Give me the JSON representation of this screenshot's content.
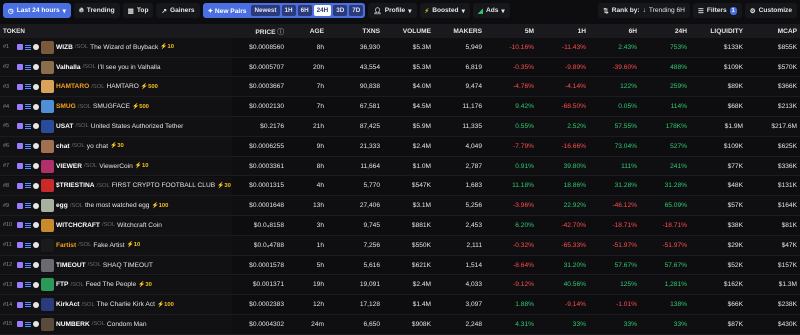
{
  "toolbar": {
    "timeframe": "Last 24 hours",
    "trending": "Trending",
    "top": "Top",
    "gainers": "Gainers",
    "new_pairs": "New Pairs",
    "newest": "Newest",
    "tf_options": [
      "1H",
      "6H",
      "24H",
      "3D",
      "7D"
    ],
    "tf_active": "24H",
    "profile": "Profile",
    "boosted": "Boosted",
    "ads": "Ads",
    "rank_by": "Rank by:",
    "rank_value": "Trending 6H",
    "filters": "Filters",
    "filters_count": "1",
    "customize": "Customize"
  },
  "columns": {
    "token": "TOKEN",
    "price": "PRICE",
    "age": "AGE",
    "txns": "TXNS",
    "volume": "VOLUME",
    "makers": "MAKERS",
    "m5": "5M",
    "h1": "1H",
    "h6": "6H",
    "h24": "24H",
    "liquidity": "LIQUIDITY",
    "mcap": "MCAP"
  },
  "rows": [
    {
      "rank": "#1",
      "symbol": "WIZB",
      "quote": "/SOL",
      "name": "The Wizard of Buyback",
      "boost": "⚡10",
      "sym_orange": false,
      "avatar": "#7a5a3a",
      "price": "$0.0008560",
      "age": "8h",
      "txns": "36,930",
      "volume": "$5.3M",
      "makers": "5,949",
      "m5": "-10.16%",
      "h1": "-11.43%",
      "h6": "2.43%",
      "h24": "753%",
      "liquidity": "$133K",
      "mcap": "$855K"
    },
    {
      "rank": "#2",
      "symbol": "Valhalla",
      "quote": "/SOL",
      "name": "I'll see you in Valhalla",
      "boost": "",
      "sym_orange": false,
      "avatar": "#8a6d4a",
      "price": "$0.0005707",
      "age": "20h",
      "txns": "43,554",
      "volume": "$5.3M",
      "makers": "6,819",
      "m5": "-0.35%",
      "h1": "-9.89%",
      "h6": "-39.60%",
      "h24": "488%",
      "liquidity": "$109K",
      "mcap": "$570K"
    },
    {
      "rank": "#3",
      "symbol": "HAMTARO",
      "quote": "/SOL",
      "name": "HAMTARO",
      "boost": "⚡500",
      "sym_orange": true,
      "avatar": "#d9a45a",
      "price": "$0.0003667",
      "age": "7h",
      "txns": "90,838",
      "volume": "$4.0M",
      "makers": "9,474",
      "m5": "-4.76%",
      "h1": "-4.14%",
      "h6": "122%",
      "h24": "259%",
      "liquidity": "$89K",
      "mcap": "$366K"
    },
    {
      "rank": "#4",
      "symbol": "SMUG",
      "quote": "/SOL",
      "name": "SMUGFACE",
      "boost": "⚡500",
      "sym_orange": true,
      "avatar": "#4f8fd6",
      "price": "$0.0002130",
      "age": "7h",
      "txns": "67,581",
      "volume": "$4.5M",
      "makers": "11,176",
      "m5": "9.42%",
      "h1": "-68.50%",
      "h6": "0.05%",
      "h24": "114%",
      "liquidity": "$68K",
      "mcap": "$213K"
    },
    {
      "rank": "#5",
      "symbol": "USAT",
      "quote": "/SOL",
      "name": "United States Authorized Tether",
      "boost": "",
      "sym_orange": false,
      "avatar": "#2a4a9a",
      "price": "$0.2176",
      "age": "21h",
      "txns": "87,425",
      "volume": "$5.9M",
      "makers": "11,335",
      "m5": "0.55%",
      "h1": "2.52%",
      "h6": "57.55%",
      "h24": "178K%",
      "liquidity": "$1.9M",
      "mcap": "$217.6M"
    },
    {
      "rank": "#6",
      "symbol": "chat",
      "quote": "/SOL",
      "name": "yo chat",
      "boost": "⚡30",
      "sym_orange": false,
      "avatar": "#a07050",
      "price": "$0.0006255",
      "age": "9h",
      "txns": "21,333",
      "volume": "$2.4M",
      "makers": "4,049",
      "m5": "-7.79%",
      "h1": "-16.66%",
      "h6": "73.04%",
      "h24": "527%",
      "liquidity": "$109K",
      "mcap": "$625K"
    },
    {
      "rank": "#7",
      "symbol": "VIEWER",
      "quote": "/SOL",
      "name": "ViewerCoin",
      "boost": "⚡10",
      "sym_orange": false,
      "avatar": "#b0306a",
      "price": "$0.0003361",
      "age": "8h",
      "txns": "11,664",
      "volume": "$1.0M",
      "makers": "2,787",
      "m5": "0.91%",
      "h1": "39.80%",
      "h6": "111%",
      "h24": "241%",
      "liquidity": "$77K",
      "mcap": "$336K"
    },
    {
      "rank": "#8",
      "symbol": "$TRIESTINA",
      "quote": "/SOL",
      "name": "FIRST CRYPTO FOOTBALL CLUB",
      "boost": "⚡30",
      "sym_orange": false,
      "avatar": "#c82a2a",
      "price": "$0.0001315",
      "age": "4h",
      "txns": "5,770",
      "volume": "$547K",
      "makers": "1,683",
      "m5": "11.18%",
      "h1": "18.86%",
      "h6": "31.28%",
      "h24": "31.28%",
      "liquidity": "$48K",
      "mcap": "$131K"
    },
    {
      "rank": "#9",
      "symbol": "egg",
      "quote": "/SOL",
      "name": "the most watched egg",
      "boost": "⚡100",
      "sym_orange": false,
      "avatar": "#a8b0a0",
      "price": "$0.0001648",
      "age": "13h",
      "txns": "27,406",
      "volume": "$3.1M",
      "makers": "5,256",
      "m5": "-3.96%",
      "h1": "22.92%",
      "h6": "-46.12%",
      "h24": "65.09%",
      "liquidity": "$57K",
      "mcap": "$164K"
    },
    {
      "rank": "#10",
      "symbol": "WITCHCRAFT",
      "quote": "/SOL",
      "name": "Witchcraft Coin",
      "boost": "",
      "sym_orange": false,
      "avatar": "#c88a2a",
      "price": "$0.0₄8158",
      "age": "3h",
      "txns": "9,745",
      "volume": "$881K",
      "makers": "2,453",
      "m5": "6.20%",
      "h1": "-42.70%",
      "h6": "-18.71%",
      "h24": "-18.71%",
      "liquidity": "$38K",
      "mcap": "$81K"
    },
    {
      "rank": "#11",
      "symbol": "Fartist",
      "quote": "/SOL",
      "name": "Fake Artist",
      "boost": "⚡10",
      "sym_orange": true,
      "avatar": "#1a1a1a",
      "price": "$0.0₄4788",
      "age": "1h",
      "txns": "7,256",
      "volume": "$550K",
      "makers": "2,111",
      "m5": "-0.32%",
      "h1": "-65.33%",
      "h6": "-51.97%",
      "h24": "-51.97%",
      "liquidity": "$29K",
      "mcap": "$47K"
    },
    {
      "rank": "#12",
      "symbol": "TIMEOUT",
      "quote": "/SOL",
      "name": "SHAQ TIMEOUT",
      "boost": "",
      "sym_orange": false,
      "avatar": "#6a6a70",
      "price": "$0.0001578",
      "age": "5h",
      "txns": "5,616",
      "volume": "$621K",
      "makers": "1,514",
      "m5": "-8.64%",
      "h1": "31.20%",
      "h6": "57.67%",
      "h24": "57.67%",
      "liquidity": "$52K",
      "mcap": "$157K"
    },
    {
      "rank": "#13",
      "symbol": "FTP",
      "quote": "/SOL",
      "name": "Feed The People",
      "boost": "⚡30",
      "sym_orange": false,
      "avatar": "#2a9a5a",
      "price": "$0.001371",
      "age": "19h",
      "txns": "19,091",
      "volume": "$2.4M",
      "makers": "4,033",
      "m5": "-9.12%",
      "h1": "40.56%",
      "h6": "125%",
      "h24": "1,281%",
      "liquidity": "$162K",
      "mcap": "$1.3M"
    },
    {
      "rank": "#14",
      "symbol": "KirkAct",
      "quote": "/SOL",
      "name": "The Charlie Kirk Act",
      "boost": "⚡100",
      "sym_orange": false,
      "avatar": "#2a3a7a",
      "price": "$0.0002383",
      "age": "12h",
      "txns": "17,128",
      "volume": "$1.4M",
      "makers": "3,097",
      "m5": "1.88%",
      "h1": "-9.14%",
      "h6": "-1.01%",
      "h24": "138%",
      "liquidity": "$66K",
      "mcap": "$238K"
    },
    {
      "rank": "#15",
      "symbol": "NUMBERK",
      "quote": "/SOL",
      "name": "Condom Man",
      "boost": "",
      "sym_orange": false,
      "avatar": "#5a4a3a",
      "price": "$0.0004302",
      "age": "24m",
      "txns": "6,650",
      "volume": "$908K",
      "makers": "2,248",
      "m5": "4.31%",
      "h1": "33%",
      "h6": "33%",
      "h24": "33%",
      "liquidity": "$87K",
      "mcap": "$430K"
    }
  ]
}
